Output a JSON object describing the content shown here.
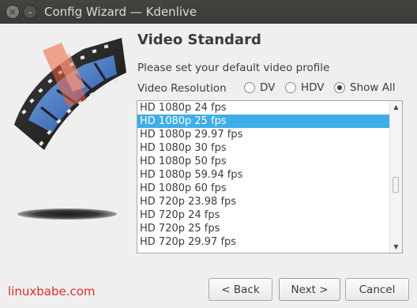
{
  "window": {
    "title": "Config Wizard — Kdenlive",
    "close_glyph": "✕",
    "minimize_glyph": "–"
  },
  "page": {
    "heading": "Video Standard",
    "subtitle": "Please set your default video profile"
  },
  "resolution": {
    "label": "Video Resolution",
    "options": [
      {
        "label": "DV",
        "checked": false
      },
      {
        "label": "HDV",
        "checked": false
      },
      {
        "label": "Show All",
        "checked": true
      }
    ]
  },
  "profiles": {
    "selected_index": 1,
    "items": [
      "HD 1080p 24 fps",
      "HD 1080p 25 fps",
      "HD 1080p 29.97 fps",
      "HD 1080p 30 fps",
      "HD 1080p 50 fps",
      "HD 1080p 59.94 fps",
      "HD 1080p 60 fps",
      "HD 720p 23.98 fps",
      "HD 720p 24 fps",
      "HD 720p 25 fps",
      "HD 720p 29.97 fps"
    ]
  },
  "buttons": {
    "back": "< Back",
    "next": "Next >",
    "cancel": "Cancel"
  },
  "watermark": "linuxbabe.com",
  "colors": {
    "selection": "#3daee9",
    "watermark": "#e52a2a",
    "titlebar": "#3d3c38"
  },
  "icons": [
    "close-icon",
    "minimize-icon",
    "film-strip-logo",
    "scroll-up-arrow",
    "scroll-down-arrow"
  ]
}
